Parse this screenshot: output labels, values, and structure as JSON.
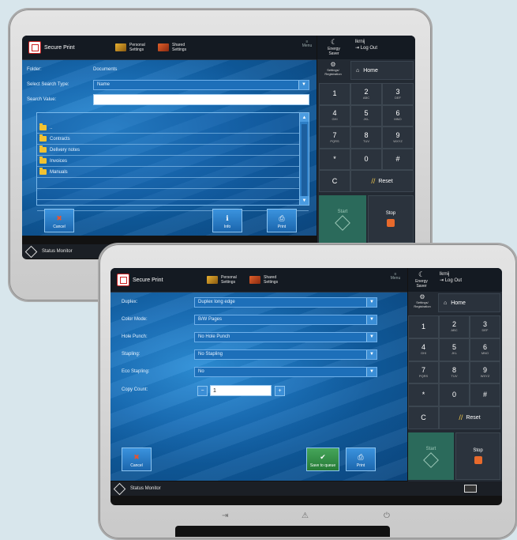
{
  "screen1": {
    "topbar": {
      "app_title": "Secure Print",
      "fav1": "Personal Settings",
      "fav2": "Shared Settings",
      "menu_label": "Menu"
    },
    "rpanel": {
      "energy": "Energy Saver",
      "user": "lkrnij",
      "logout": "Log Out",
      "settings": "Settings/ Registration",
      "home": "Home"
    },
    "form": {
      "folder_label": "Folder:",
      "folder_value": "Documents",
      "search_type_label": "Select Search Type:",
      "search_type_value": "Name",
      "search_value_label": "Search Value:",
      "search_value": ""
    },
    "list_items": [
      "..",
      "Contracts",
      "Delivery notes",
      "Invoices",
      "Manuals"
    ],
    "buttons": {
      "cancel": "Cancel",
      "info": "Info",
      "print": "Print"
    },
    "status": "Status Monitor",
    "keys": [
      {
        "k": "1",
        "s": ""
      },
      {
        "k": "2",
        "s": "ABC"
      },
      {
        "k": "3",
        "s": "DEF"
      },
      {
        "k": "4",
        "s": "GHI"
      },
      {
        "k": "5",
        "s": "JKL"
      },
      {
        "k": "6",
        "s": "MNO"
      },
      {
        "k": "7",
        "s": "PQRS"
      },
      {
        "k": "8",
        "s": "TUV"
      },
      {
        "k": "9",
        "s": "WXYZ"
      },
      {
        "k": "*",
        "s": ""
      },
      {
        "k": "0",
        "s": ""
      },
      {
        "k": "#",
        "s": ""
      }
    ],
    "clear": "C",
    "reset": "Reset",
    "start": "Start",
    "stop": "Stop"
  },
  "screen2": {
    "topbar": {
      "app_title": "Secure Print",
      "fav1": "Personal Settings",
      "fav2": "Shared Settings",
      "menu_label": "Menu"
    },
    "rpanel": {
      "energy": "Energy Saver",
      "user": "lkrnij",
      "logout": "Log Out",
      "settings": "Settings/ Registration",
      "home": "Home"
    },
    "options": [
      {
        "label": "Duplex:",
        "value": "Duplex long edge"
      },
      {
        "label": "Color Mode:",
        "value": "B/W Pages"
      },
      {
        "label": "Hole Punch:",
        "value": "No Hole Punch"
      },
      {
        "label": "Stapling:",
        "value": "No Stapling"
      },
      {
        "label": "Eco Stapling:",
        "value": "No"
      }
    ],
    "copy_count_label": "Copy Count:",
    "copy_count": "1",
    "buttons": {
      "cancel": "Cancel",
      "save_queue": "Save to queue",
      "print": "Print"
    },
    "status": "Status Monitor",
    "keys": [
      {
        "k": "1",
        "s": ""
      },
      {
        "k": "2",
        "s": "ABC"
      },
      {
        "k": "3",
        "s": "DEF"
      },
      {
        "k": "4",
        "s": "GHI"
      },
      {
        "k": "5",
        "s": "JKL"
      },
      {
        "k": "6",
        "s": "MNO"
      },
      {
        "k": "7",
        "s": "PQRS"
      },
      {
        "k": "8",
        "s": "TUV"
      },
      {
        "k": "9",
        "s": "WXYZ"
      },
      {
        "k": "*",
        "s": ""
      },
      {
        "k": "0",
        "s": ""
      },
      {
        "k": "#",
        "s": ""
      }
    ],
    "clear": "C",
    "reset": "Reset",
    "start": "Start",
    "stop": "Stop"
  }
}
